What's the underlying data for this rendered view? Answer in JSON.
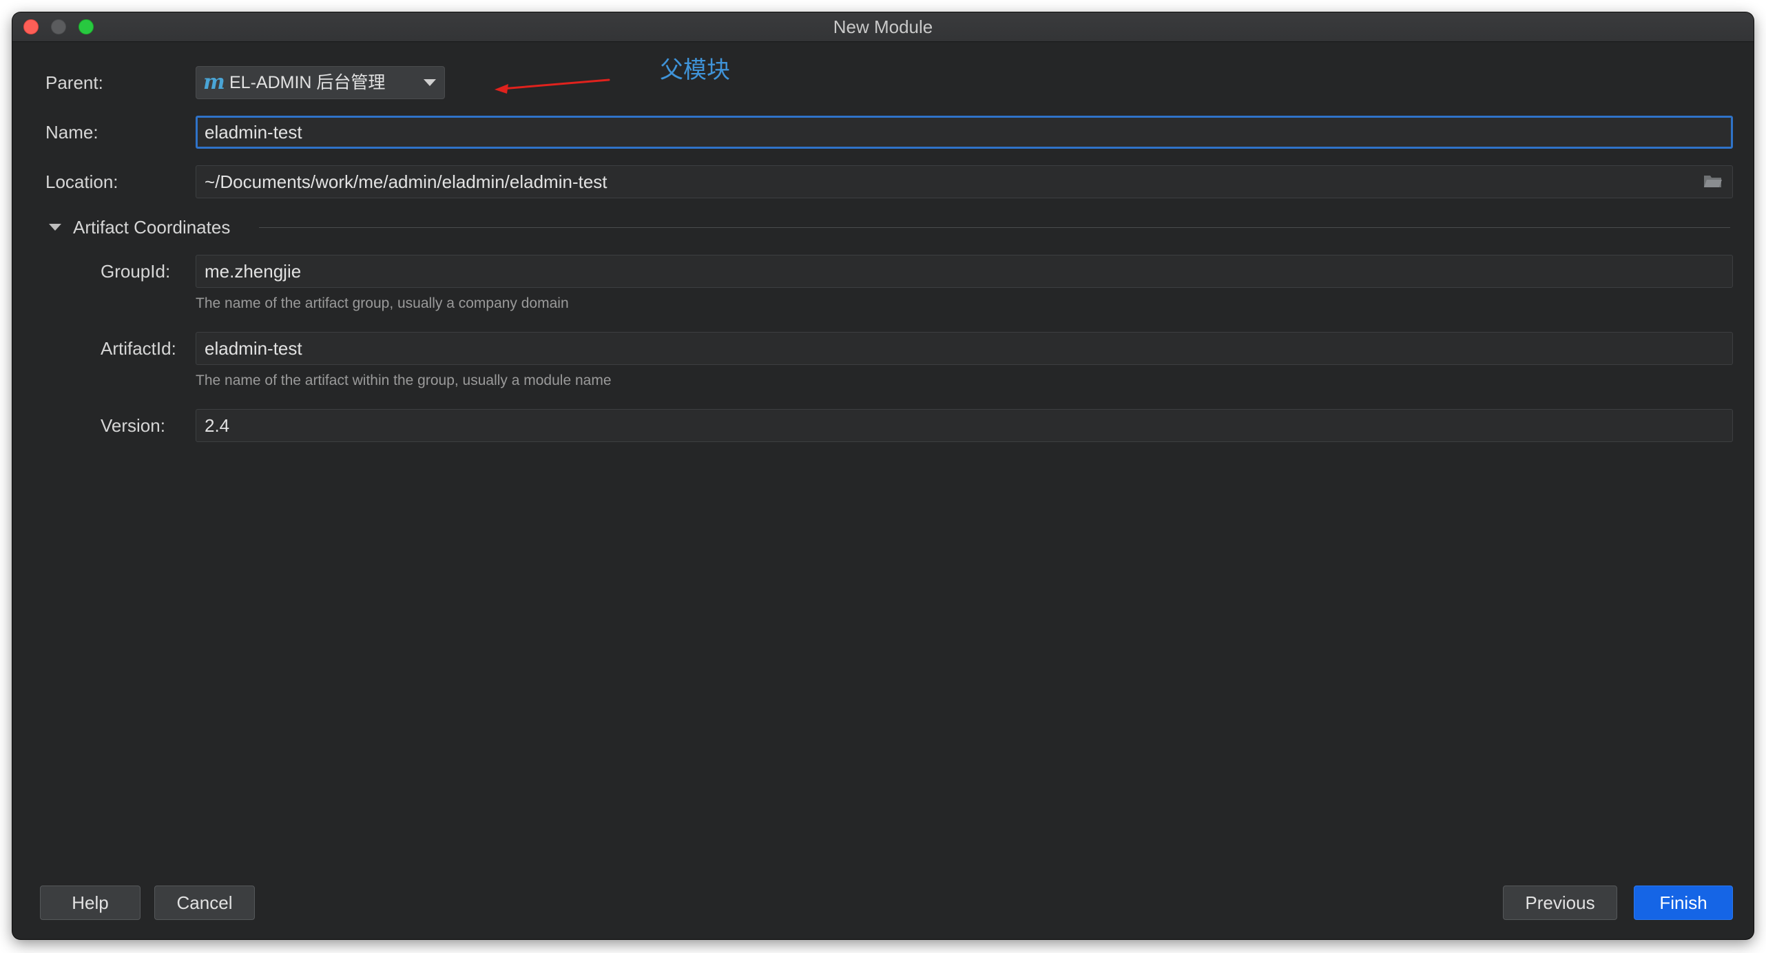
{
  "window": {
    "title": "New Module"
  },
  "form": {
    "parent_label": "Parent:",
    "parent_value": "EL-ADMIN 后台管理",
    "parent_icon": "m",
    "annotation": "父模块",
    "name_label": "Name:",
    "name_value": "eladmin-test",
    "location_label": "Location:",
    "location_value": "~/Documents/work/me/admin/eladmin/eladmin-test"
  },
  "artifact": {
    "section_title": "Artifact Coordinates",
    "group_label": "GroupId:",
    "group_value": "me.zhengjie",
    "group_hint": "The name of the artifact group, usually a company domain",
    "artifact_label": "ArtifactId:",
    "artifact_value": "eladmin-test",
    "artifact_hint": "The name of the artifact within the group, usually a module name",
    "version_label": "Version:",
    "version_value": "2.4"
  },
  "buttons": {
    "help": "Help",
    "cancel": "Cancel",
    "previous": "Previous",
    "finish": "Finish"
  },
  "colors": {
    "background": "#252627",
    "focus_border": "#2f73c9",
    "primary_button": "#1565e6",
    "annotation_arrow": "#e0221d",
    "annotation_text": "#3f93d8"
  }
}
